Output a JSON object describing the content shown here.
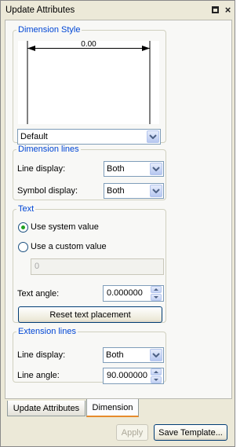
{
  "window": {
    "title": "Update Attributes",
    "pin_icon": "pin-icon",
    "close_icon": "close-icon",
    "close_glyph": "×"
  },
  "dimension_style": {
    "legend": "Dimension Style",
    "preview_value": "0.00",
    "style_select": "Default"
  },
  "dimension_lines": {
    "legend": "Dimension lines",
    "line_display_label": "Line display:",
    "line_display_value": "Both",
    "symbol_display_label": "Symbol display:",
    "symbol_display_value": "Both"
  },
  "text": {
    "legend": "Text",
    "use_system_value_label": "Use system value",
    "use_system_value_selected": true,
    "use_custom_value_label": "Use a custom value",
    "custom_value": "0",
    "text_angle_label": "Text angle:",
    "text_angle_value": "0.000000",
    "reset_button": "Reset text placement"
  },
  "extension_lines": {
    "legend": "Extension lines",
    "line_display_label": "Line display:",
    "line_display_value": "Both",
    "line_angle_label": "Line angle:",
    "line_angle_value": "90.000000"
  },
  "tabs": [
    {
      "label": "Update Attributes",
      "active": false
    },
    {
      "label": "Dimension",
      "active": true
    }
  ],
  "footer": {
    "apply_button": "Apply",
    "apply_enabled": false,
    "save_template_button": "Save Template..."
  },
  "colors": {
    "legend_text": "#0046d5",
    "panel_bg": "#ece9d8",
    "active_tab_highlight": "#e68b2c"
  }
}
